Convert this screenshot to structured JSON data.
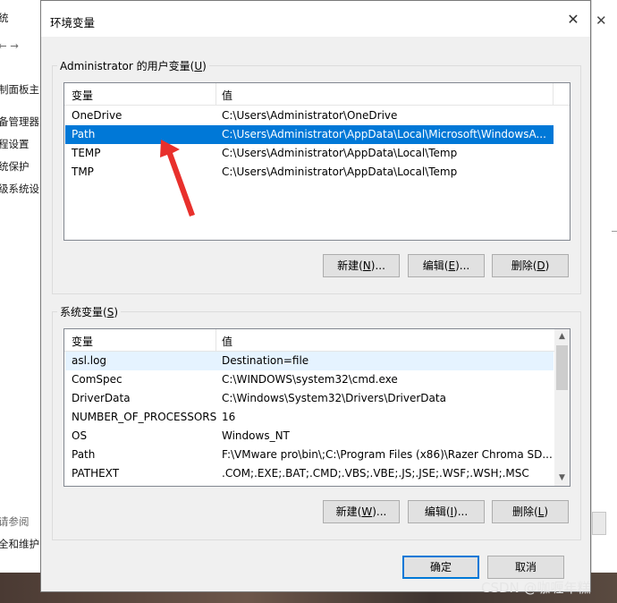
{
  "background": {
    "left_fragments": [
      "统",
      "制面板主",
      "备管理器",
      "程设置",
      "统保护",
      "级系统设",
      "请参阅",
      "全和维护"
    ]
  },
  "dialog": {
    "title": "环境变量",
    "close_label": "✕",
    "user_group": {
      "label_prefix": "Administrator 的用户变量(",
      "label_key": "U",
      "label_suffix": ")",
      "columns": [
        "变量",
        "值"
      ],
      "rows": [
        {
          "name": "OneDrive",
          "value": "C:\\Users\\Administrator\\OneDrive"
        },
        {
          "name": "Path",
          "value": "C:\\Users\\Administrator\\AppData\\Local\\Microsoft\\WindowsA..."
        },
        {
          "name": "TEMP",
          "value": "C:\\Users\\Administrator\\AppData\\Local\\Temp"
        },
        {
          "name": "TMP",
          "value": "C:\\Users\\Administrator\\AppData\\Local\\Temp"
        }
      ],
      "selected_index": 1,
      "buttons": [
        {
          "pre": "新建(",
          "key": "N",
          "post": ")..."
        },
        {
          "pre": "编辑(",
          "key": "E",
          "post": ")..."
        },
        {
          "pre": "删除(",
          "key": "D",
          "post": ")"
        }
      ]
    },
    "system_group": {
      "label_prefix": "系统变量(",
      "label_key": "S",
      "label_suffix": ")",
      "columns": [
        "变量",
        "值"
      ],
      "rows": [
        {
          "name": "asl.log",
          "value": "Destination=file"
        },
        {
          "name": "ComSpec",
          "value": "C:\\WINDOWS\\system32\\cmd.exe"
        },
        {
          "name": "DriverData",
          "value": "C:\\Windows\\System32\\Drivers\\DriverData"
        },
        {
          "name": "NUMBER_OF_PROCESSORS",
          "value": "16"
        },
        {
          "name": "OS",
          "value": "Windows_NT"
        },
        {
          "name": "Path",
          "value": "F:\\VMware pro\\bin\\;C:\\Program Files (x86)\\Razer Chroma SD..."
        },
        {
          "name": "PATHEXT",
          "value": ".COM;.EXE;.BAT;.CMD;.VBS;.VBE;.JS;.JSE;.WSF;.WSH;.MSC"
        }
      ],
      "selected_index": 0,
      "buttons": [
        {
          "pre": "新建(",
          "key": "W",
          "post": ")..."
        },
        {
          "pre": "编辑(",
          "key": "I",
          "post": ")..."
        },
        {
          "pre": "删除(",
          "key": "L",
          "post": ")"
        }
      ]
    },
    "ok_label": "确定",
    "cancel_label": "取消"
  },
  "watermark": "CSDN @咖喱年糕",
  "colors": {
    "selection": "#0078d7",
    "annotation_arrow": "#e8302c"
  }
}
